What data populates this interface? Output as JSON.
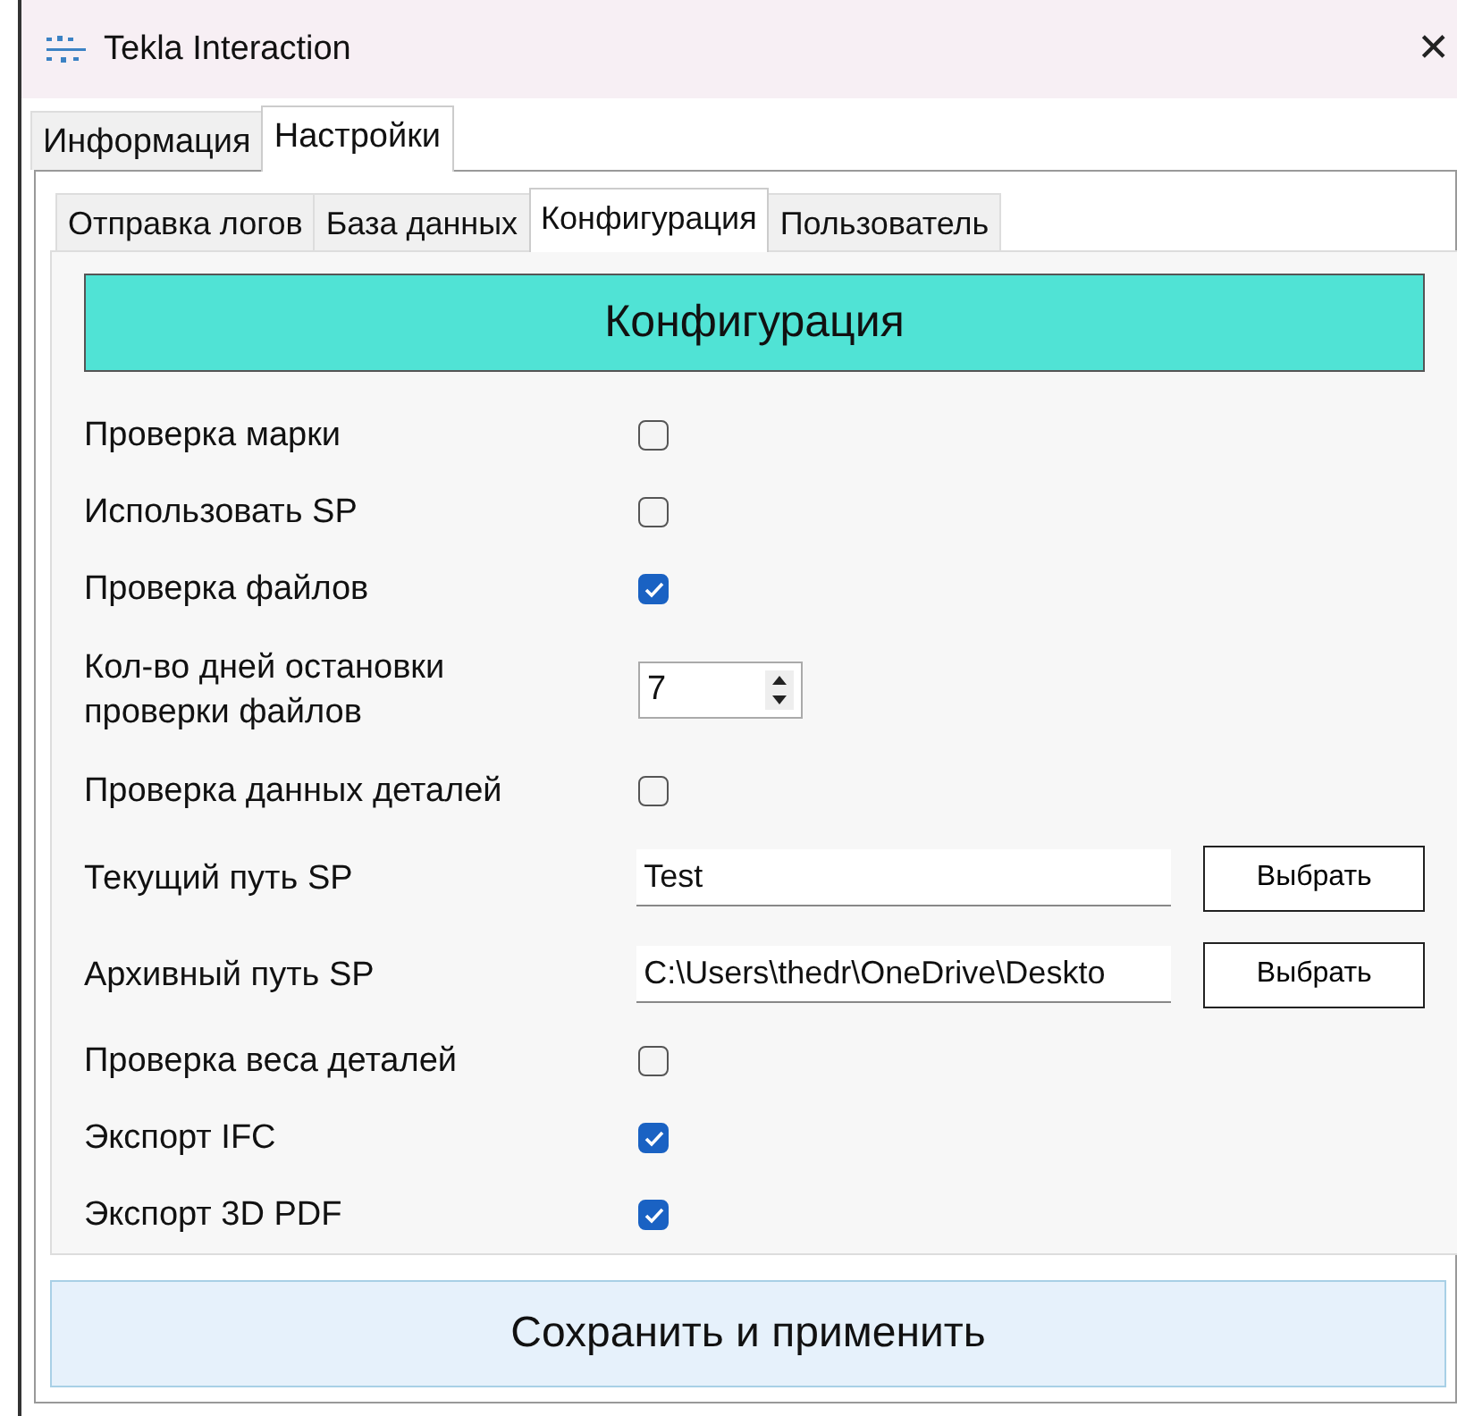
{
  "window": {
    "title": "Tekla Interaction",
    "close": "✕"
  },
  "tabs": [
    {
      "label": "Информация",
      "selected": false
    },
    {
      "label": "Настройки",
      "selected": true
    }
  ],
  "subtabs": [
    {
      "label": "Отправка логов",
      "selected": false
    },
    {
      "label": "База данных",
      "selected": false
    },
    {
      "label": "Конфигурация",
      "selected": true
    },
    {
      "label": "Пользователь",
      "selected": false
    }
  ],
  "header": "Конфигурация",
  "settings": [
    {
      "kind": "checkbox",
      "label": "Проверка марки",
      "checked": false
    },
    {
      "kind": "checkbox",
      "label": "Использовать SP",
      "checked": false
    },
    {
      "kind": "checkbox",
      "label": "Проверка файлов",
      "checked": true
    },
    {
      "kind": "spinner",
      "label": "Кол-во дней остановки проверки файлов",
      "value": "7"
    },
    {
      "kind": "checkbox",
      "label": "Проверка данных деталей",
      "checked": false
    },
    {
      "kind": "path",
      "label": "Текущий путь SP",
      "value": "Test",
      "button": "Выбрать"
    },
    {
      "kind": "path",
      "label": "Архивный путь SP",
      "value": "C:\\Users\\thedr\\OneDrive\\Deskto",
      "button": "Выбрать"
    },
    {
      "kind": "checkbox",
      "label": "Проверка веса деталей",
      "checked": false
    },
    {
      "kind": "checkbox",
      "label": "Экспорт IFC",
      "checked": true
    },
    {
      "kind": "checkbox",
      "label": "Экспорт 3D PDF",
      "checked": true
    }
  ],
  "save_button": "Сохранить и применить"
}
